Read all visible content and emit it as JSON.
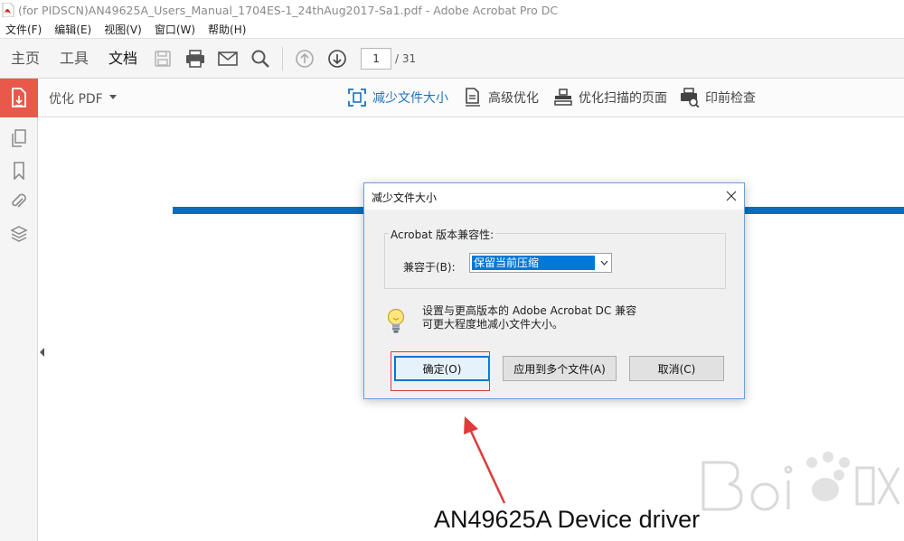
{
  "window": {
    "title": "(for PIDSCN)AN49625A_Users_Manual_1704ES-1_24thAug2017-Sa1.pdf - Adobe Acrobat Pro DC"
  },
  "menubar": {
    "items": [
      "文件(F)",
      "编辑(E)",
      "视图(V)",
      "窗口(W)",
      "帮助(H)"
    ]
  },
  "toolbar": {
    "tabs": [
      "主页",
      "工具",
      "文档"
    ],
    "active_tab": "文档",
    "page_current": "1",
    "page_total": "/ 31"
  },
  "subbar": {
    "optimize_label": "优化 PDF",
    "tools": [
      "减少文件大小",
      "高级优化",
      "优化扫描的页面",
      "印前检查"
    ],
    "active_tool": "减少文件大小"
  },
  "document": {
    "heading": "AN49625A  Device driver"
  },
  "dialog": {
    "title": "减少文件大小",
    "group_label": "Acrobat 版本兼容性:",
    "compat_label": "兼容于(B):",
    "compat_value": "保留当前压缩",
    "info_line1": "设置与更高版本的 Adobe Acrobat DC 兼容",
    "info_line2": "可更大程度地减小文件大小。",
    "buttons": {
      "ok": "确定(O)",
      "apply_multiple": "应用到多个文件(A)",
      "cancel": "取消(C)"
    }
  },
  "colors": {
    "accent_blue": "#0a6cc0",
    "tool_tile": "#e8594b",
    "annotation_red": "#e03a3a"
  }
}
